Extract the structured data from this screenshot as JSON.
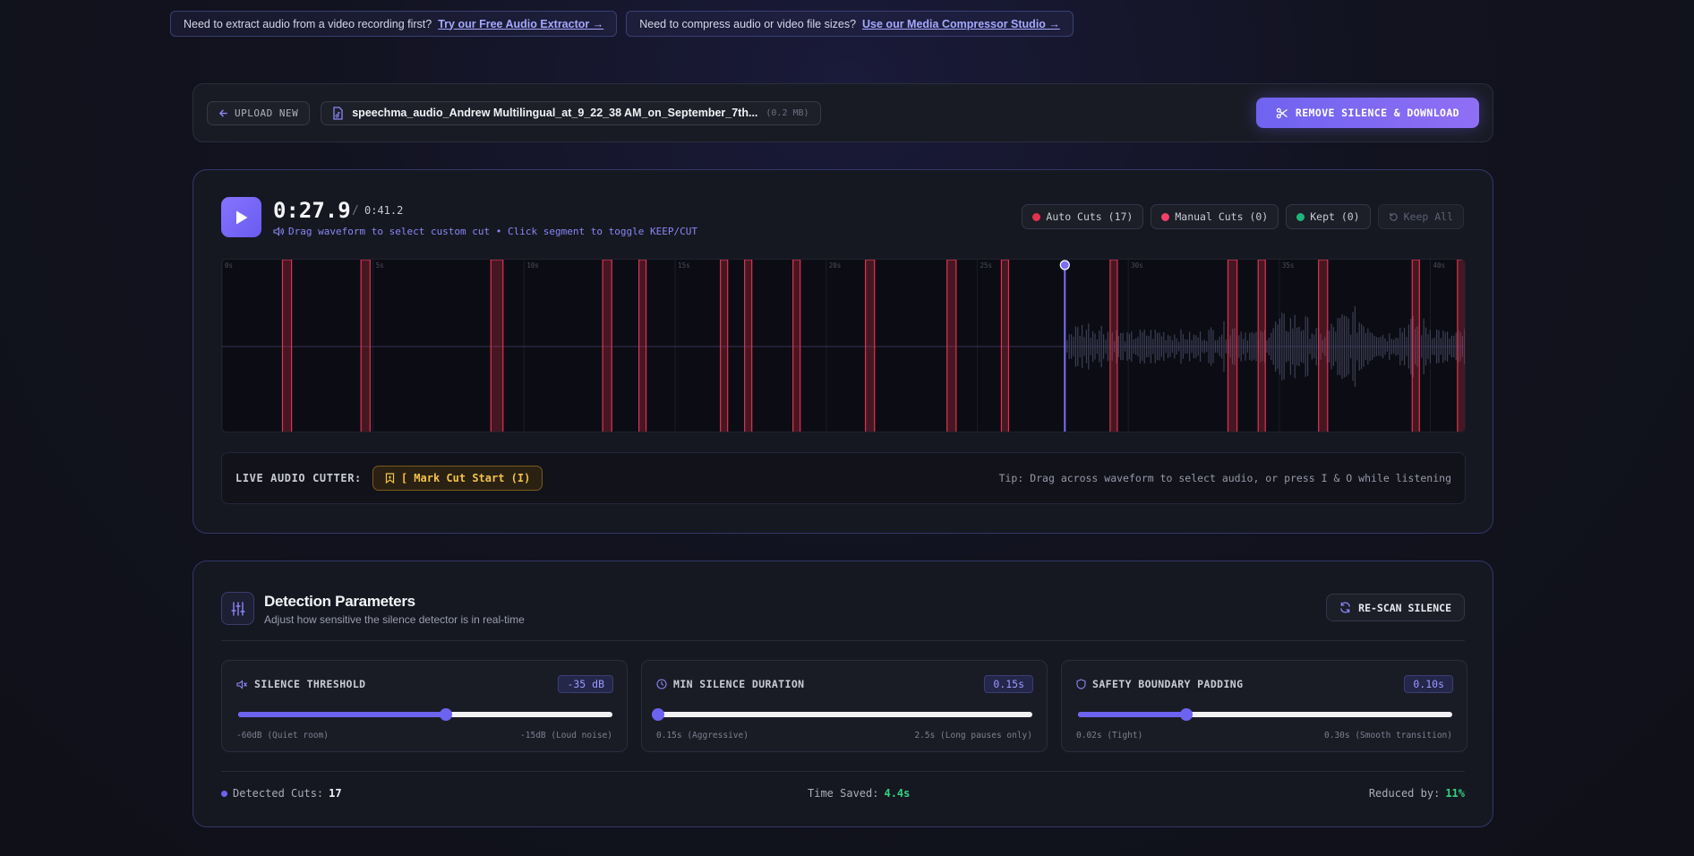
{
  "promos": [
    {
      "text": "Need to extract audio from a video recording first?",
      "link": "Try our Free Audio Extractor →"
    },
    {
      "text": "Need to compress audio or video file sizes?",
      "link": "Use our Media Compressor Studio →"
    }
  ],
  "filebar": {
    "upload_label": "UPLOAD NEW",
    "filename": "speechma_audio_Andrew Multilingual_at_9_22_38 AM_on_September_7th...",
    "filesize": "(0.2 MB)",
    "action_label": "REMOVE SILENCE & DOWNLOAD"
  },
  "player": {
    "current_time": "0:27.9",
    "separator": "/",
    "total_time": "0:41.2",
    "hint": "Drag waveform to select custom cut • Click segment to toggle KEEP/CUT",
    "chips": {
      "auto_cuts": "Auto Cuts (17)",
      "manual_cuts": "Manual Cuts (0)",
      "kept": "Kept (0)",
      "keep_all": "Keep All"
    },
    "colors": {
      "auto": "#e0334d",
      "manual": "#f0416a",
      "kept": "#1fb57a",
      "accent": "#7d6df6"
    },
    "waveform": {
      "duration_s": 41.2,
      "playhead_s": 27.9,
      "tick_labels": [
        "0s",
        "5s",
        "10s",
        "15s",
        "20s",
        "25s",
        "30s",
        "35s",
        "40s"
      ],
      "cut_regions_s": [
        [
          2.0,
          2.3
        ],
        [
          4.6,
          4.9
        ],
        [
          8.9,
          9.3
        ],
        [
          12.6,
          12.9
        ],
        [
          13.8,
          14.0
        ],
        [
          16.5,
          16.7
        ],
        [
          17.3,
          17.4
        ],
        [
          18.9,
          19.1
        ],
        [
          21.3,
          21.6
        ],
        [
          24.0,
          24.3
        ],
        [
          25.8,
          26.0
        ],
        [
          29.4,
          29.6
        ],
        [
          33.3,
          33.6
        ],
        [
          34.3,
          34.5
        ],
        [
          36.3,
          36.6
        ],
        [
          39.4,
          39.6
        ],
        [
          40.9,
          41.2
        ]
      ]
    }
  },
  "cutter": {
    "label": "LIVE AUDIO CUTTER:",
    "mark_label": "[ Mark Cut Start (I)",
    "tip": "Tip: Drag across waveform to select audio, or press I & O while listening"
  },
  "detection": {
    "title": "Detection Parameters",
    "subtitle": "Adjust how sensitive the silence detector is in real-time",
    "rescan_label": "RE-SCAN SILENCE",
    "params": [
      {
        "icon": "speaker-mute-icon",
        "title": "SILENCE THRESHOLD",
        "value": "-35 dB",
        "fraction": 0.556,
        "min_label": "-60dB (Quiet room)",
        "max_label": "-15dB (Loud noise)"
      },
      {
        "icon": "clock-icon",
        "title": "MIN SILENCE DURATION",
        "value": "0.15s",
        "fraction": 0.0,
        "min_label": "0.15s (Aggressive)",
        "max_label": "2.5s (Long pauses only)"
      },
      {
        "icon": "shield-icon",
        "title": "SAFETY BOUNDARY PADDING",
        "value": "0.10s",
        "fraction": 0.29,
        "min_label": "0.02s (Tight)",
        "max_label": "0.30s (Smooth transition)"
      }
    ],
    "stats": {
      "detected_label": "Detected Cuts:",
      "detected_value": "17",
      "saved_label": "Time Saved:",
      "saved_value": "4.4s",
      "reduced_label": "Reduced by:",
      "reduced_value": "11%"
    }
  }
}
